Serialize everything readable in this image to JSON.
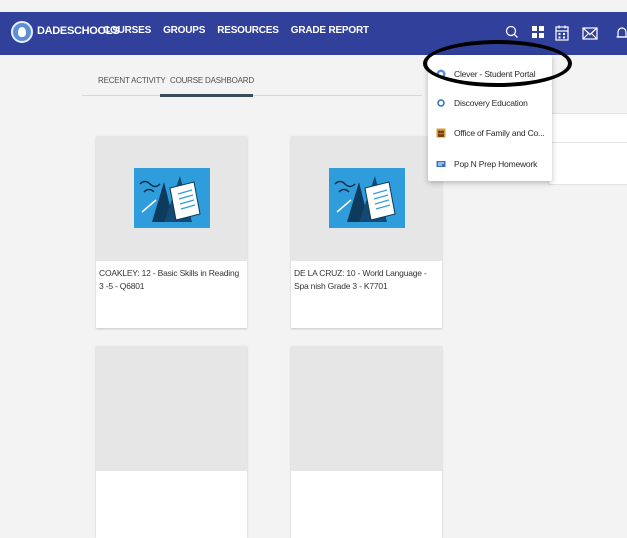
{
  "header": {
    "brand": "DADESCHOOLS",
    "nav": [
      "COURSES",
      "GROUPS",
      "RESOURCES",
      "GRADE REPORT"
    ],
    "icons": [
      "search-icon",
      "apps-grid-icon",
      "calendar-icon",
      "mail-icon",
      "notification-icon"
    ]
  },
  "tabs": {
    "recent": "RECENT ACTIVITY",
    "dashboard": "COURSE DASHBOARD"
  },
  "courses": [
    {
      "label": "COAKLEY: 12 - Basic Skills in Reading 3 -5 - Q6801"
    },
    {
      "label": "DE LA CRUZ: 10 - World Language - Spa nish Grade 3 - K7701"
    },
    {
      "label": ""
    },
    {
      "label": ""
    }
  ],
  "apps_dropdown": {
    "items": [
      {
        "label": "Clever - Student Portal",
        "icon": "clever-icon"
      },
      {
        "label": "Discovery Education",
        "icon": "discovery-icon"
      },
      {
        "label": "Office of Family and Co...",
        "icon": "family-office-icon"
      },
      {
        "label": "Pop N Prep Homework",
        "icon": "pop-n-prep-icon"
      }
    ]
  },
  "colors": {
    "header_bg": "#31419b",
    "page_bg": "#f3f3f3",
    "card_art_blue": "#2f9ddb",
    "highlight": "#000000"
  }
}
